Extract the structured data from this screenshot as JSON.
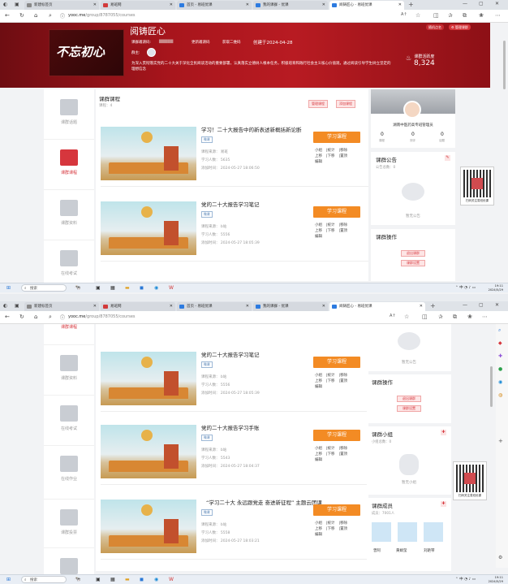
{
  "browser": {
    "tabs": [
      {
        "label": "新建标签页",
        "color": "#888888"
      },
      {
        "label": "易班网",
        "color": "#d23a3a"
      },
      {
        "label": "首页 - 易班优课",
        "color": "#2d7be0"
      },
      {
        "label": "我的课群 - 优课",
        "color": "#2d7be0"
      },
      {
        "label": "阅铸匠心 - 易班优课",
        "color": "#2d7be0"
      }
    ],
    "url_host": "yooc.me",
    "url_path": "/group/8787055/courses",
    "new_tab": "+",
    "controls": [
      "—",
      "▢",
      "✕"
    ]
  },
  "banner": {
    "title": "阅铸匠心",
    "logo_text": "不忘初心",
    "invite_label": "课群邀请码:",
    "invite_code": "▇▇▇▇▇",
    "change_invite": "更新邀请码",
    "qr_link": "获取二维码",
    "created": "创建于2024-04-28",
    "owner_label": "群主:",
    "description": "为深入贯彻落实党的二十大关于深化全民阅读活动的重要部署，认真落实立德树人根本任务，积极培育和践行社会主义核心价值观，通过阅读引导学生树立坚定的理想信念",
    "btn_apply": "随机点名",
    "btn_manage": "管理课群",
    "activity_label": "课群活跃度",
    "activity_value": "8,324"
  },
  "leftnav": [
    {
      "label": "课群话题",
      "icon": "chat-icon"
    },
    {
      "label": "课群课程",
      "icon": "book-icon",
      "active": true
    },
    {
      "label": "课群资料",
      "icon": "files-icon"
    },
    {
      "label": "在线考试",
      "icon": "laptop-icon"
    },
    {
      "label": "在线作业",
      "icon": "clipboard-icon"
    },
    {
      "label": "课群投票",
      "icon": "vote-icon"
    }
  ],
  "courses_section": {
    "title": "课群课程",
    "count": "课程：4",
    "btn_manage": "管理课程",
    "btn_add": "添加课程"
  },
  "courses": [
    {
      "title": "学习！二十大报告中的新表述新概括新论断",
      "tag": "微课",
      "source": "课程来源：  易班",
      "learners": "学习人数：  5635",
      "added": "添加时间：  2024-05-27 18:06:50"
    },
    {
      "title": "党的二十大报告学习笔记",
      "tag": "微课",
      "source": "课程来源：  b站",
      "learners": "学习人数：  5556",
      "added": "添加时间：  2024-05-27 18:05:39"
    },
    {
      "title": "党的二十大报告学习手账",
      "tag": "微课",
      "source": "课程来源：  b站",
      "learners": "学习人数：  5543",
      "added": "添加时间：  2024-05-27 18:04:37"
    },
    {
      "title": "“学习二十大 永远跟党走 奋进新征程” 主题云团课",
      "tag": "微课",
      "source": "课程来源：  b站",
      "learners": "学习人数：  5558",
      "added": "添加时间：  2024-05-27 18:03:21"
    }
  ],
  "course_actions": {
    "learn": "学习课程",
    "row1": [
      "小组",
      "统计",
      "移除"
    ],
    "row2": [
      "上移",
      "下移",
      "置顶"
    ],
    "row3": [
      "编辑"
    ]
  },
  "profile": {
    "school": "湖南中医药高专班管理员",
    "stats": [
      {
        "value": "0",
        "label": "课程"
      },
      {
        "value": "0",
        "label": "测评"
      },
      {
        "value": "0",
        "label": "话题"
      }
    ]
  },
  "announcement": {
    "title": "课群公告",
    "count": "公告总数：0",
    "empty": "暂无公告"
  },
  "operations": {
    "title": "课群操作",
    "buttons": [
      "退出课群",
      "课群设置"
    ]
  },
  "groups": {
    "title": "课群小组",
    "count": "小组总数：0",
    "empty": "暂无小组"
  },
  "members": {
    "title": "课群成员",
    "count": "成员：7001人",
    "names": [
      "曾阿",
      "黄娟莹",
      "刘艳琴"
    ]
  },
  "qr": {
    "label": "扫码关注易班优课"
  },
  "taskbar": {
    "search": "搜索",
    "time": "19:11",
    "date": "2024/5/29",
    "lang": "中"
  }
}
